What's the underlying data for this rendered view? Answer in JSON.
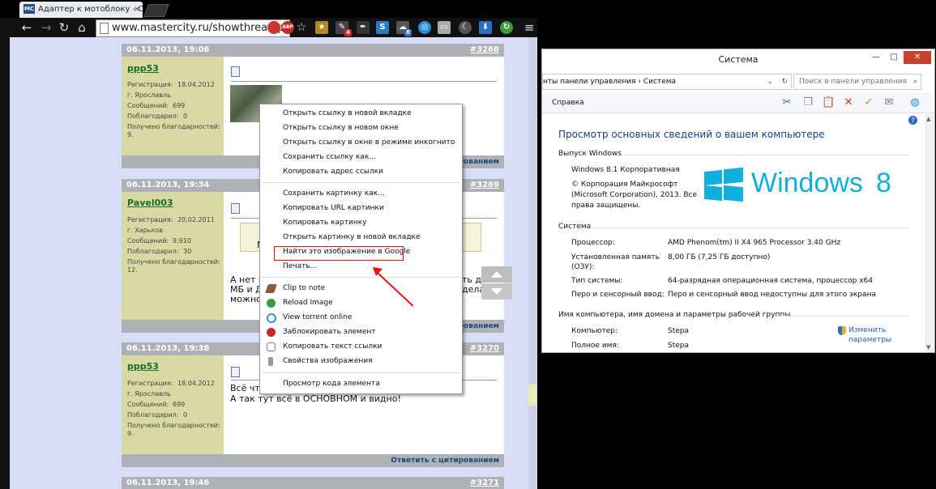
{
  "browser": {
    "tab_title": "Адаптер к мотоблоку - С",
    "tab_favicon_text": "MC",
    "tab_close": "×",
    "url": "www.mastercity.ru/showthread.php",
    "nav": {
      "back": "←",
      "forward": "→",
      "reload": "↻",
      "home": "⌂",
      "star": "☆",
      "menu": "≡"
    },
    "extension_icons": [
      "abp-icon",
      "bookmark-icon",
      "clip-icon",
      "feather-icon",
      "s-icon",
      "cloud-icon",
      "chrome-app-icon",
      "window-icon",
      "moon-icon",
      "download-icon",
      "refresh-green-icon"
    ],
    "extension_badges": [
      "4",
      "8"
    ]
  },
  "posts": [
    {
      "date": "06.11.2013, 19:06",
      "number": "#3268",
      "user": "ppp53",
      "fields": [
        {
          "label": "Регистрация:",
          "value": "18.04.2012"
        },
        {
          "label": "г. Ярославль",
          "value": ""
        },
        {
          "label": "Сообщений:",
          "value": "699"
        },
        {
          "label": "Поблагодарил:",
          "value": "0"
        },
        {
          "label": "Получено благодарностей:",
          "value": ""
        },
        {
          "label": "9.",
          "value": ""
        }
      ],
      "footer": "Ответить с цитированием"
    },
    {
      "date": "06.11.2013, 19:34",
      "number": "#3269",
      "user": "Pavel003",
      "fields": [
        {
          "label": "Регистрация:",
          "value": "20.02.2011"
        },
        {
          "label": "г. Харьков",
          "value": ""
        },
        {
          "label": "Сообщений:",
          "value": "9,910"
        },
        {
          "label": "Поблагодарил:",
          "value": "30"
        },
        {
          "label": "Получено благодарностей:",
          "value": ""
        },
        {
          "label": "12.",
          "value": ""
        }
      ],
      "body_fragments": [
        "А нет к",
        "МБ и Д",
        "можно",
        "ть два",
        "делать",
        "М"
      ],
      "footer": "Ответить с цитированием"
    },
    {
      "date": "06.11.2013, 19:38",
      "number": "#3270",
      "user": "ppp53",
      "fields": [
        {
          "label": "Регистрация:",
          "value": "18.04.2012"
        },
        {
          "label": "г. Ярославль",
          "value": ""
        },
        {
          "label": "Сообщений:",
          "value": "699"
        },
        {
          "label": "Поблагодарил:",
          "value": "0"
        },
        {
          "label": "Получено благодарностей:",
          "value": ""
        },
        {
          "label": "9.",
          "value": ""
        }
      ],
      "body_lines": [
        "Всё чт",
        "А так тут всё в ОСНОВНОМ и видно!"
      ],
      "footer": "Ответить с цитированием"
    },
    {
      "date": "06.11.2013, 19:46",
      "number": "#3271"
    }
  ],
  "context_menu": {
    "group1": [
      "Открыть ссылку в новой вкладке",
      "Открыть ссылку в новом окне",
      "Открыть ссылку в окне в режиме инкогнито",
      "Сохранить ссылку как...",
      "Копировать адрес ссылки"
    ],
    "group2": [
      "Сохранить картинку как...",
      "Копировать URL картинки",
      "Копировать картинку",
      "Открыть картинку в новой вкладке",
      "Найти это изображение в Google",
      "Печать..."
    ],
    "group3": [
      {
        "label": "Clip to note",
        "icon": "clip-note-icon",
        "color": "#8a5a3a"
      },
      {
        "label": "Reload Image",
        "icon": "reload-image-icon",
        "color": "#2ea043"
      },
      {
        "label": "View torrent online",
        "icon": "torrent-icon",
        "color": "#3a8fd0"
      },
      {
        "label": "Заблокировать элемент",
        "icon": "abp-icon",
        "color": "#c62828"
      },
      {
        "label": "Копировать текст ссылки",
        "icon": "link-icon",
        "color": "#777777"
      },
      {
        "label": "Свойства изображения",
        "icon": "info-icon",
        "color": "#999999"
      }
    ],
    "group4": [
      "Просмотр кода элемента"
    ],
    "highlighted_item": "Найти это изображение в Google",
    "highlight_color": "#dd1111"
  },
  "system_window": {
    "title": "Система",
    "window_buttons": {
      "minimize": "—",
      "maximize": "□",
      "close": "✕"
    },
    "address": "нты панели управления  ›  Система",
    "search_placeholder": "Поиск в панели управления",
    "menu": "Справка",
    "toolbar_icons": [
      "cut-icon",
      "copy-icon",
      "paste-icon",
      "delete-icon",
      "check-icon",
      "mail-icon",
      "globe-icon"
    ],
    "heading": "Просмотр основных сведений о вашем компьютере",
    "edition_section": "Выпуск Windows",
    "edition": "Windows 8.1 Корпоративная",
    "copyright": [
      "© Корпорация Майкрософт",
      "(Microsoft Corporation), 2013. Все",
      "права защищены."
    ],
    "logo_text": "Windows",
    "logo_version": "8",
    "system_section": "Система",
    "rows": [
      {
        "label": "Процессор:",
        "value": "AMD Phenom(tm) II X4 965 Processor   3.40 GHz"
      },
      {
        "label": "Установленная память",
        "value": "8,00 ГБ (7,25 ГБ доступно)"
      },
      {
        "label": "(ОЗУ):",
        "value": ""
      },
      {
        "label": "Тип системы:",
        "value": "64-разрядная операционная система, процессор x64"
      },
      {
        "label": "Перо и сенсорный ввод:",
        "value": "Перо и сенсорный ввод недоступны для этого экрана"
      }
    ],
    "computer_section": "Имя компьютера, имя домена и параметры рабочей группы",
    "computer_rows": [
      {
        "label": "Компьютер:",
        "value": "Stepa"
      },
      {
        "label": "Полное имя:",
        "value": "Stepa"
      }
    ],
    "change_link": [
      "Изменить",
      "параметры"
    ],
    "accent_color": "#11aee0"
  }
}
